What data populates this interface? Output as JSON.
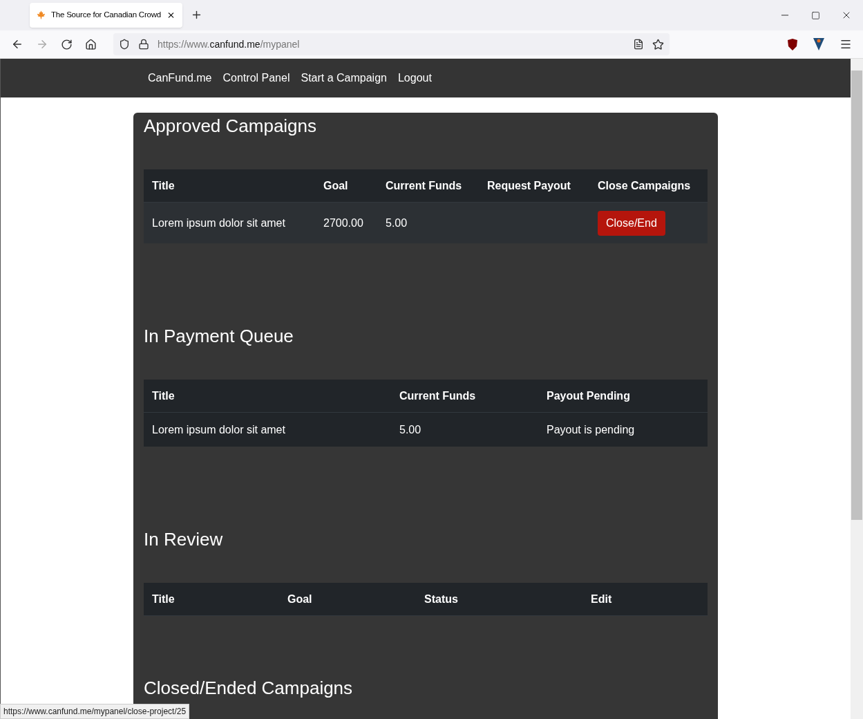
{
  "browser": {
    "tab": {
      "title": "The Source for Canadian Crowd",
      "selected": true
    },
    "url": {
      "host": "canfund.me",
      "prefix": "https://www.",
      "path": "/mypanel"
    }
  },
  "nav": {
    "links": [
      "CanFund.me",
      "Control Panel",
      "Start a Campaign",
      "Logout"
    ]
  },
  "sections": [
    {
      "heading": "Approved Campaigns",
      "columns": [
        "Title",
        "Goal",
        "Current Funds",
        "Request Payout",
        "Close Campaigns"
      ],
      "rows": [
        [
          {
            "kind": "text",
            "text": "Lorem ipsum dolor sit amet"
          },
          {
            "kind": "text",
            "text": "2700.00"
          },
          {
            "kind": "text",
            "text": "5.00"
          },
          {
            "kind": "blank"
          },
          {
            "kind": "button",
            "text": "Close/End"
          }
        ]
      ]
    },
    {
      "heading": "In Payment Queue",
      "columns": [
        "Title",
        "Current Funds",
        "Payout Pending"
      ],
      "rows": [
        [
          {
            "kind": "text",
            "text": "Lorem ipsum dolor sit amet"
          },
          {
            "kind": "text",
            "text": "5.00"
          },
          {
            "kind": "text",
            "text": "Payout is pending"
          }
        ]
      ]
    },
    {
      "heading": "In Review",
      "columns": [
        "Title",
        "Goal",
        "Status",
        "Edit"
      ]
    },
    {
      "heading": "Closed/Ended Campaigns"
    }
  ],
  "status_link": "https://www.canfund.me/mypanel/close-project/25"
}
